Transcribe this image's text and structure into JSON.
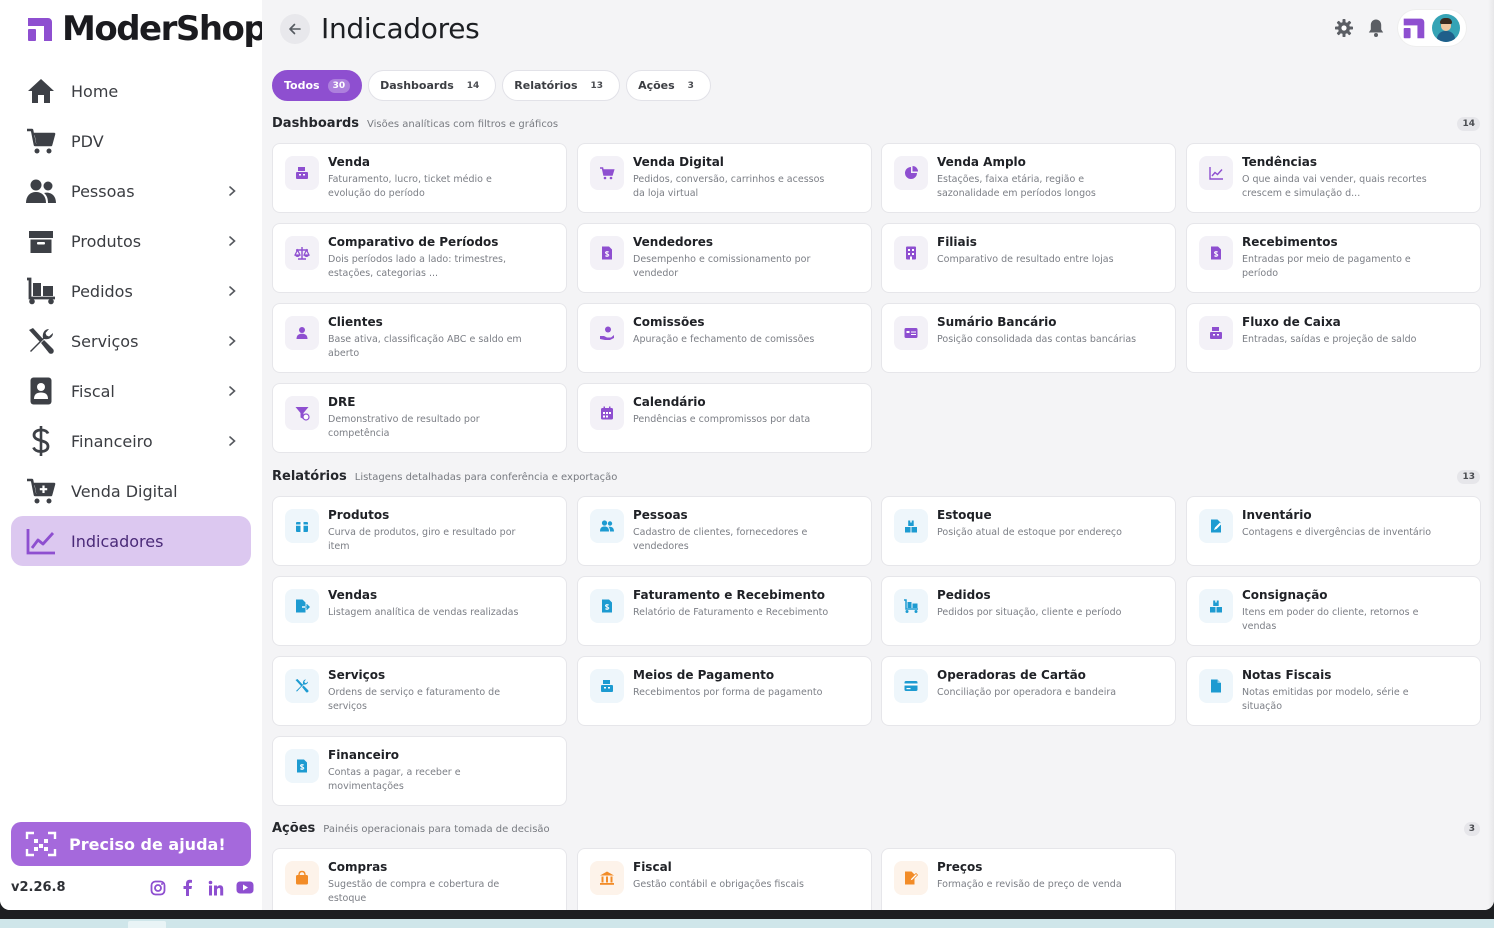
{
  "app": {
    "logo_text": "ModerShop",
    "version": "v2.26.8"
  },
  "colors": {
    "accent": "#8e4fd0",
    "active_bg": "#dcc8f0",
    "help_bg": "#a569dc"
  },
  "sidebar": {
    "items": [
      {
        "label": "Home",
        "icon": "home-icon",
        "chevron": false,
        "active": false
      },
      {
        "label": "PDV",
        "icon": "cart-icon",
        "chevron": false,
        "active": false
      },
      {
        "label": "Pessoas",
        "icon": "people-icon",
        "chevron": true,
        "active": false
      },
      {
        "label": "Produtos",
        "icon": "box-icon",
        "chevron": true,
        "active": false
      },
      {
        "label": "Pedidos",
        "icon": "dolly-icon",
        "chevron": true,
        "active": false
      },
      {
        "label": "Serviços",
        "icon": "tools-icon",
        "chevron": true,
        "active": false
      },
      {
        "label": "Fiscal",
        "icon": "badge-icon",
        "chevron": true,
        "active": false
      },
      {
        "label": "Financeiro",
        "icon": "dollar-icon",
        "chevron": true,
        "active": false
      },
      {
        "label": "Venda Digital",
        "icon": "cart-plus-icon",
        "chevron": false,
        "active": false
      },
      {
        "label": "Indicadores",
        "icon": "chart-line-icon",
        "chevron": false,
        "active": true
      }
    ],
    "help_label": "Preciso de ajuda!",
    "socials": [
      "instagram-icon",
      "facebook-icon",
      "linkedin-icon",
      "youtube-icon"
    ]
  },
  "header": {
    "title": "Indicadores"
  },
  "tabs": [
    {
      "label": "Todos",
      "count": "30",
      "active": true
    },
    {
      "label": "Dashboards",
      "count": "14",
      "active": false
    },
    {
      "label": "Relatórios",
      "count": "13",
      "active": false
    },
    {
      "label": "Ações",
      "count": "3",
      "active": false
    }
  ],
  "sections": [
    {
      "title": "Dashboards",
      "desc": "Visões analíticas com filtros e gráficos",
      "count": "14",
      "cards": [
        {
          "title": "Venda",
          "desc": "Faturamento, lucro, ticket médio e evolução do período",
          "icon": "cash-register-icon"
        },
        {
          "title": "Venda Digital",
          "desc": "Pedidos, conversão, carrinhos e acessos da loja virtual",
          "icon": "cart-icon"
        },
        {
          "title": "Venda Amplo",
          "desc": "Estações, faixa etária, região e sazonalidade em períodos longos",
          "icon": "pie-chart-icon"
        },
        {
          "title": "Tendências",
          "desc": "O que ainda vai vender, quais recortes crescem e simulação d...",
          "icon": "trend-icon"
        },
        {
          "title": "Comparativo de Períodos",
          "desc": "Dois períodos lado a lado: trimestres, estações, categorias ...",
          "icon": "scale-icon"
        },
        {
          "title": "Vendedores",
          "desc": "Desempenho e comissionamento por vendedor",
          "icon": "invoice-icon"
        },
        {
          "title": "Filiais",
          "desc": "Comparativo de resultado entre lojas",
          "icon": "building-icon"
        },
        {
          "title": "Recebimentos",
          "desc": "Entradas por meio de pagamento e período",
          "icon": "receipt-icon"
        },
        {
          "title": "Clientes",
          "desc": "Base ativa, classificação ABC e saldo em aberto",
          "icon": "user-icon"
        },
        {
          "title": "Comissões",
          "desc": "Apuração e fechamento de comissões",
          "icon": "hand-coin-icon"
        },
        {
          "title": "Sumário Bancário",
          "desc": "Posição consolidada das contas bancárias",
          "icon": "bank-card-icon"
        },
        {
          "title": "Fluxo de Caixa",
          "desc": "Entradas, saídas e projeção de saldo",
          "icon": "cash-register-icon"
        },
        {
          "title": "DRE",
          "desc": "Demonstrativo de resultado por competência",
          "icon": "funnel-dollar-icon"
        },
        {
          "title": "Calendário",
          "desc": "Pendências e compromissos por data",
          "icon": "calendar-icon"
        }
      ]
    },
    {
      "title": "Relatórios",
      "desc": "Listagens detalhadas para conferência e exportação",
      "count": "13",
      "cards": [
        {
          "title": "Produtos",
          "desc": "Curva de produtos, giro e resultado por item",
          "icon": "gift-box-icon"
        },
        {
          "title": "Pessoas",
          "desc": "Cadastro de clientes, fornecedores e vendedores",
          "icon": "people-icon"
        },
        {
          "title": "Estoque",
          "desc": "Posição atual de estoque por endereço",
          "icon": "boxes-icon"
        },
        {
          "title": "Inventário",
          "desc": "Contagens e divergências de inventário",
          "icon": "file-edit-icon"
        },
        {
          "title": "Vendas",
          "desc": "Listagem analítica de vendas realizadas",
          "icon": "file-export-icon"
        },
        {
          "title": "Faturamento e Recebimento",
          "desc": "Relatório de Faturamento e Recebimento",
          "icon": "file-dollar-icon"
        },
        {
          "title": "Pedidos",
          "desc": "Pedidos por situação, cliente e período",
          "icon": "dolly-icon"
        },
        {
          "title": "Consignação",
          "desc": "Itens em poder do cliente, retornos e vendas",
          "icon": "boxes-icon"
        },
        {
          "title": "Serviços",
          "desc": "Ordens de serviço e faturamento de serviços",
          "icon": "tools-icon"
        },
        {
          "title": "Meios de Pagamento",
          "desc": "Recebimentos por forma de pagamento",
          "icon": "cash-register-icon"
        },
        {
          "title": "Operadoras de Cartão",
          "desc": "Conciliação por operadora e bandeira",
          "icon": "credit-card-icon"
        },
        {
          "title": "Notas Fiscais",
          "desc": "Notas emitidas por modelo, série e situação",
          "icon": "file-icon"
        },
        {
          "title": "Financeiro",
          "desc": "Contas a pagar, a receber e movimentações",
          "icon": "file-dollar-icon"
        }
      ]
    },
    {
      "title": "Ações",
      "desc": "Painéis operacionais para tomada de decisão",
      "count": "3",
      "cards": [
        {
          "title": "Compras",
          "desc": "Sugestão de compra e cobertura de estoque",
          "icon": "shopping-bag-icon"
        },
        {
          "title": "Fiscal",
          "desc": "Gestão contábil e obrigações fiscais",
          "icon": "bank-icon"
        },
        {
          "title": "Preços",
          "desc": "Formação e revisão de preço de venda",
          "icon": "file-price-icon"
        }
      ]
    }
  ]
}
